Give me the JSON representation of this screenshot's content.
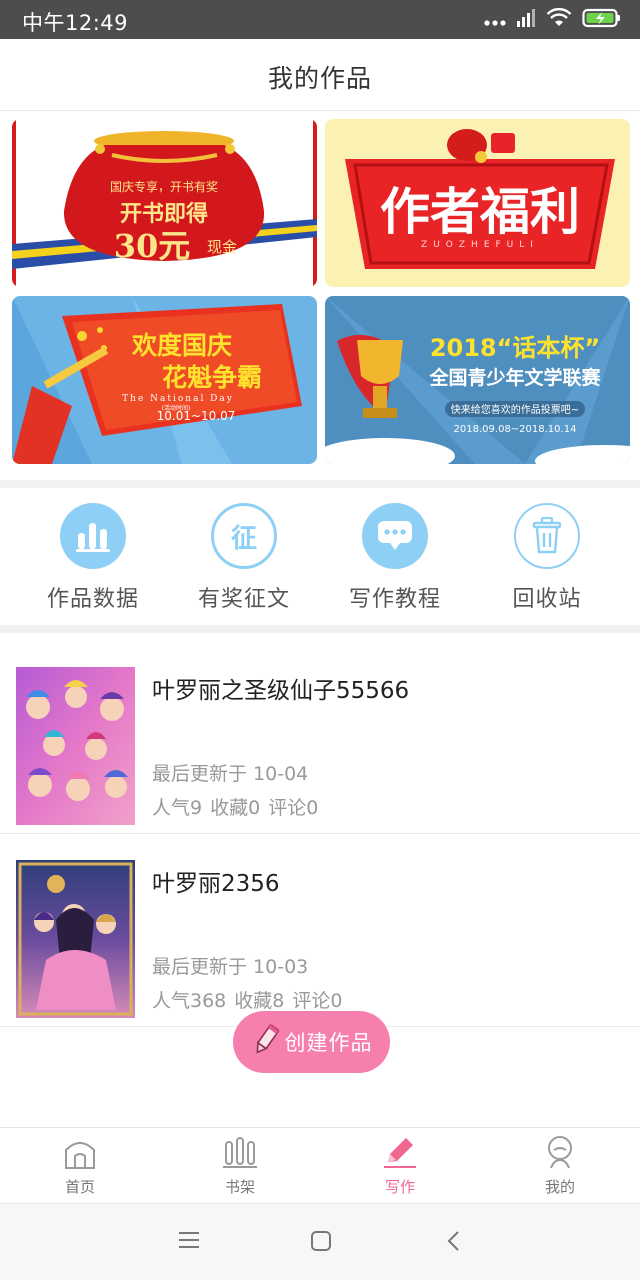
{
  "status_bar": {
    "time": "中午12:49"
  },
  "header": {
    "title": "我的作品"
  },
  "banners": [
    {
      "lines": [
        "国庆专享，开书有奖",
        "开书即得",
        "30元",
        "现金"
      ]
    },
    {
      "title": "作者福利",
      "sub": "ZUOZHEFULI"
    },
    {
      "title1": "欢度国庆",
      "title2": "花魁争霸",
      "en": "The National Day",
      "small": "(活动时间)",
      "date": "10.01~10.07"
    },
    {
      "title": "2018“话本杯”",
      "sub": "全国青少年文学联赛",
      "note": "快来给您喜欢的作品投票吧~",
      "date": "2018.09.08~2018.10.14"
    }
  ],
  "actions": [
    {
      "label": "作品数据",
      "icon": "bar-chart-icon",
      "glyph": ""
    },
    {
      "label": "有奖征文",
      "icon": "zheng-icon",
      "glyph": "征"
    },
    {
      "label": "写作教程",
      "icon": "chat-bubble-icon",
      "glyph": ""
    },
    {
      "label": "回收站",
      "icon": "trash-icon",
      "glyph": ""
    }
  ],
  "works": [
    {
      "name": "叶罗丽之圣级仙子55566",
      "updated": "最后更新于 10-04",
      "popularity": "人气9",
      "favorites": "收藏0",
      "comments": "评论0"
    },
    {
      "name": "叶罗丽2356",
      "updated": "最后更新于 10-03",
      "popularity": "人气368",
      "favorites": "收藏8",
      "comments": "评论0"
    }
  ],
  "create_button": {
    "label": "创建作品"
  },
  "tabs": [
    {
      "label": "首页",
      "icon": "home-icon"
    },
    {
      "label": "书架",
      "icon": "bookshelf-icon"
    },
    {
      "label": "写作",
      "icon": "pen-icon",
      "active": true
    },
    {
      "label": "我的",
      "icon": "profile-icon"
    }
  ],
  "colors": {
    "accent": "#f0678f",
    "action_circle": "#8ecff5",
    "create_button": "#f77fad"
  }
}
